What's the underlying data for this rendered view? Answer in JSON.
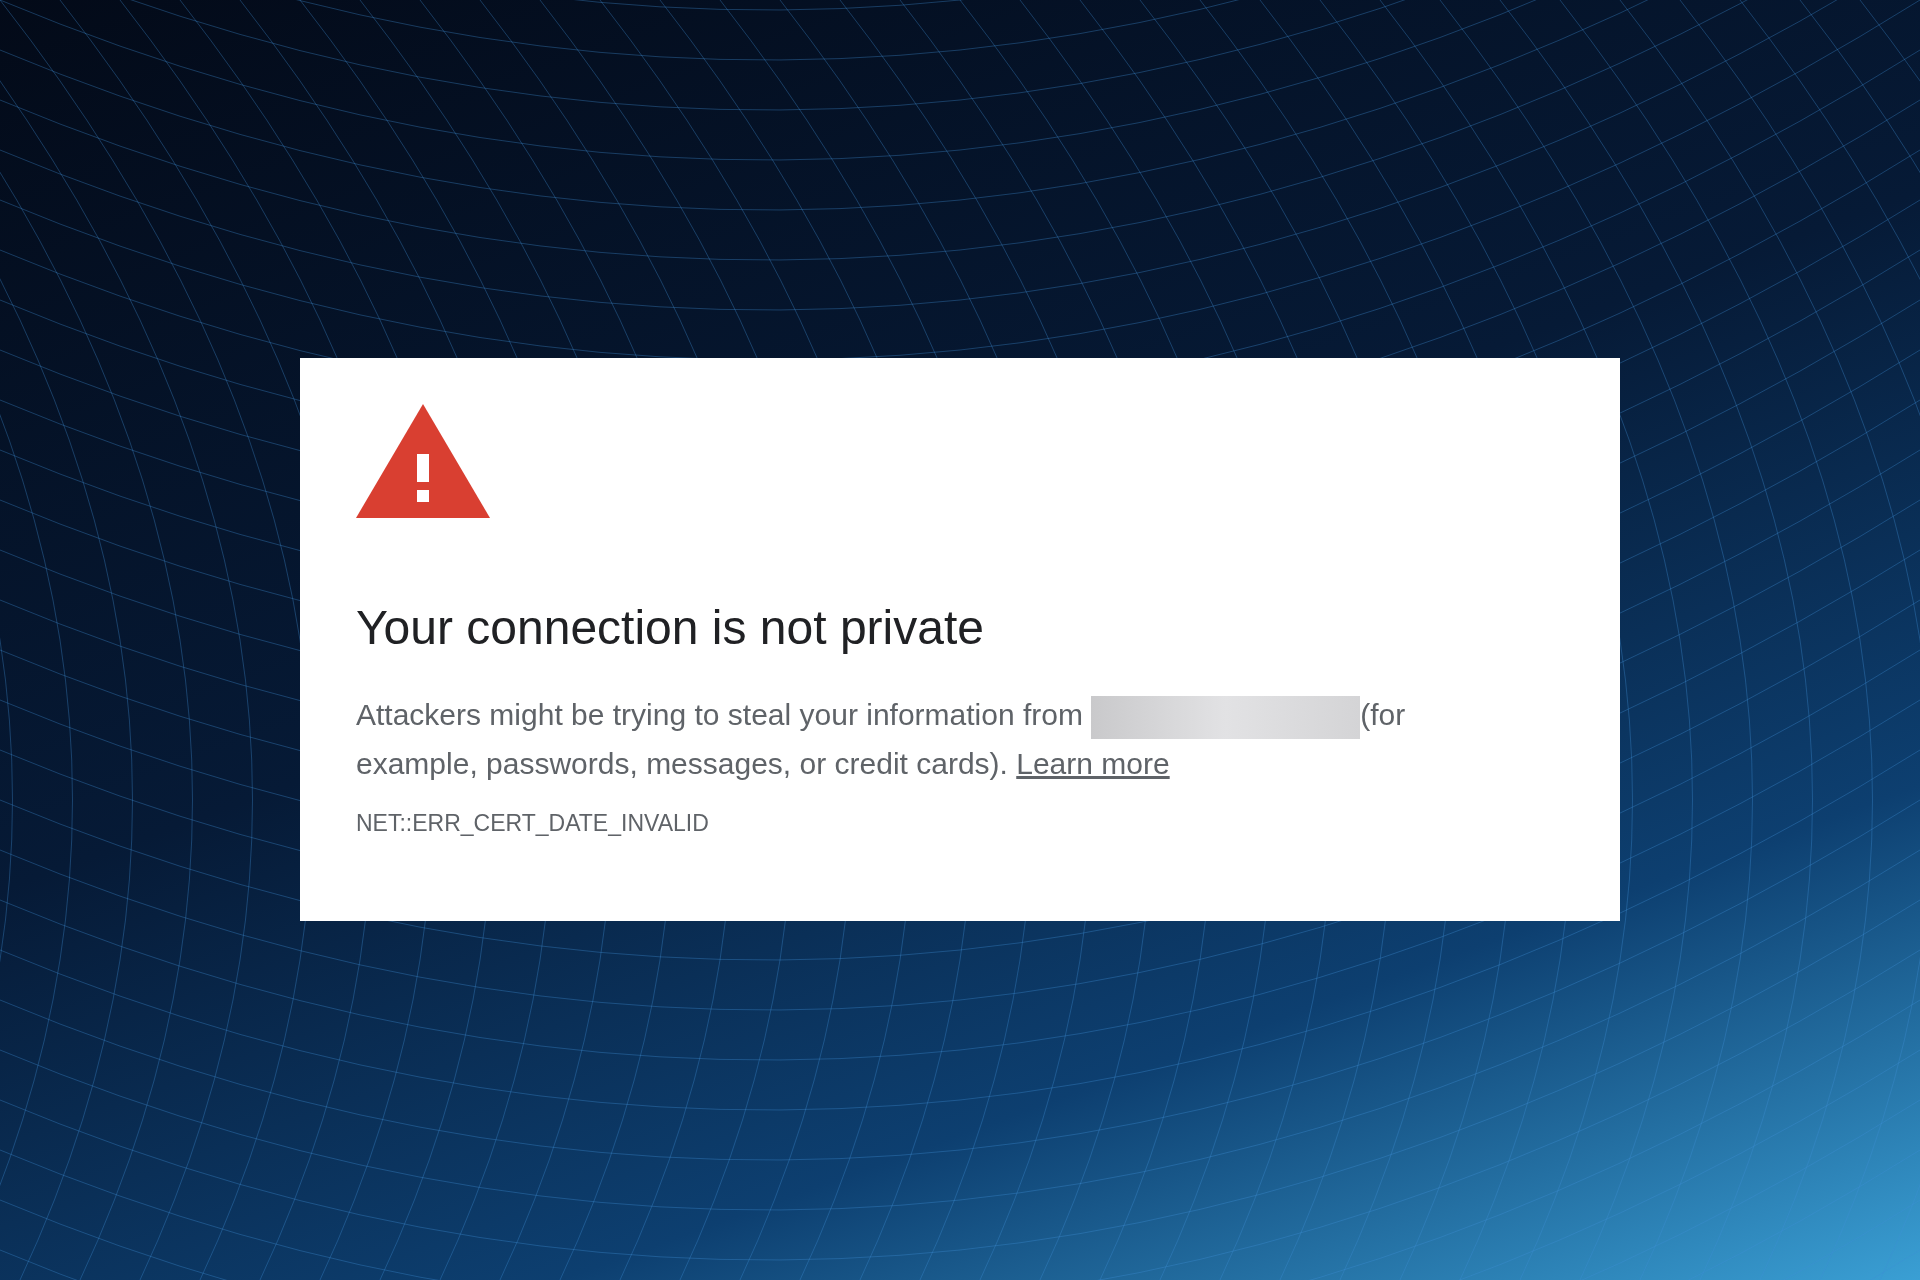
{
  "heading": "Your connection is not private",
  "message": {
    "before": "Attackers might be trying to steal your information from",
    "redacted": true,
    "after": "(for example, passwords, messages, or credit cards).",
    "link": "Learn more"
  },
  "error_code": "NET::ERR_CERT_DATE_INVALID"
}
